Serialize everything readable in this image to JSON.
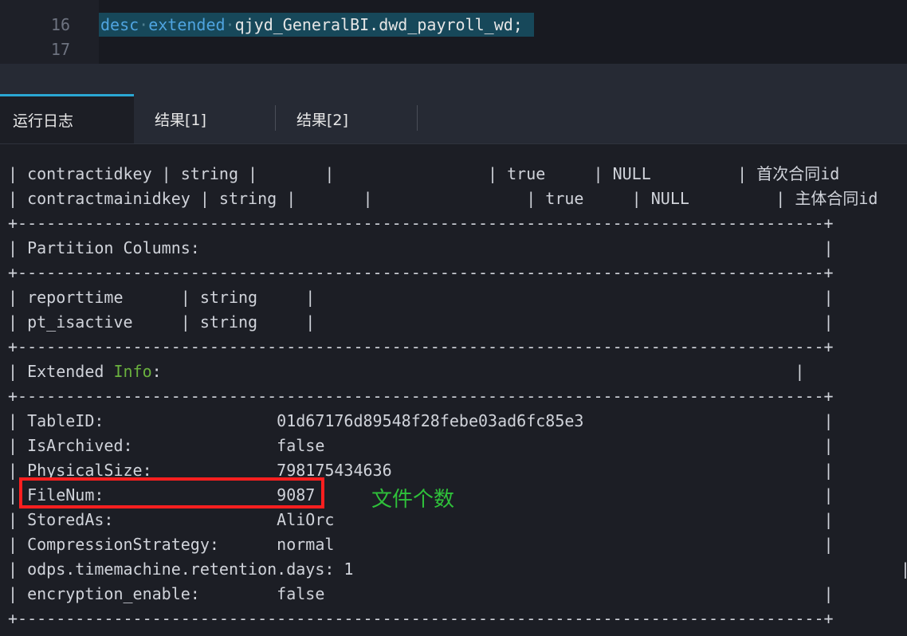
{
  "editor": {
    "lines": [
      {
        "number": "16",
        "keyword1": "desc",
        "keyword2": "extended",
        "rest": "qjyd_GeneralBI.dwd_payroll_wd;"
      },
      {
        "number": "17"
      }
    ]
  },
  "tabs": [
    {
      "label": "运行日志"
    },
    {
      "label": "结果[1]"
    },
    {
      "label": "结果[2]"
    }
  ],
  "log": {
    "lines": [
      "| contractidkey | string |       |                | true     | NULL         | 首次合同id",
      "| contractmainidkey | string |       |                | true     | NULL         | 主体合同id",
      "+------------------------------------------------------------------------------------+",
      "| Partition Columns:                                                                 |",
      "+------------------------------------------------------------------------------------+",
      "| reporttime      | string     |                                                     |",
      "| pt_isactive     | string     |                                                     |",
      "+------------------------------------------------------------------------------------+",
      "| Extended ",
      "+------------------------------------------------------------------------------------+",
      "| TableID:                  01d67176d89548f28febe03ad6fc85e3                         |",
      "| IsArchived:               false                                                    |",
      "| PhysicalSize:             798175434636                                             |",
      "| FileNum:                  9087                                                     |",
      "| StoredAs:                 AliOrc                                                   |",
      "| CompressionStrategy:      normal                                                   |",
      "| odps.timemachine.retention.days: 1                                                         |",
      "| encryption_enable:        false                                                    |",
      "+------------------------------------------------------------------------------------+"
    ],
    "extended_info_word": "Info",
    "extended_info_tail": ":                                                                  |"
  },
  "annotation": {
    "text": "文件个数",
    "color": "#2fc13a"
  },
  "colors": {
    "keyword": "#4fa4e0",
    "highlight_border": "#ff1f1f",
    "active_tab_border": "#2aa7d4",
    "info_word": "#6ab13e"
  }
}
